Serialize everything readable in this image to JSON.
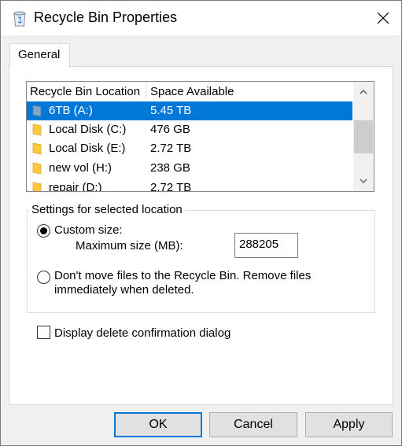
{
  "window": {
    "title": "Recycle Bin Properties"
  },
  "icons": {
    "app": "recycle-bin-icon",
    "close": "close-icon",
    "folder": "folder-icon"
  },
  "tabs": [
    {
      "label": "General",
      "selected": true
    }
  ],
  "locations": {
    "columns": [
      "Recycle Bin Location",
      "Space Available"
    ],
    "rows": [
      {
        "name": "6TB (A:)",
        "space": "5.45 TB",
        "selected": true
      },
      {
        "name": "Local Disk (C:)",
        "space": "476 GB"
      },
      {
        "name": "Local Disk (E:)",
        "space": "2.72 TB"
      },
      {
        "name": "new vol (H:)",
        "space": "238 GB"
      },
      {
        "name": "repair (D:)",
        "space": "2.72 TB"
      }
    ]
  },
  "settings": {
    "group_title": "Settings for selected location",
    "custom_size_label": "Custom size:",
    "custom_size_selected": true,
    "max_size_label": "Maximum size (MB):",
    "max_size_value": "288205",
    "remove_label_line1": "Don't move files to the Recycle Bin. Remove files",
    "remove_label_line2": "immediately when deleted.",
    "remove_selected": false
  },
  "confirm": {
    "label": "Display delete confirmation dialog",
    "checked": false
  },
  "buttons": {
    "ok": "OK",
    "cancel": "Cancel",
    "apply": "Apply"
  },
  "colors": {
    "selection": "#0078d7",
    "folder": "#ffc83d"
  }
}
